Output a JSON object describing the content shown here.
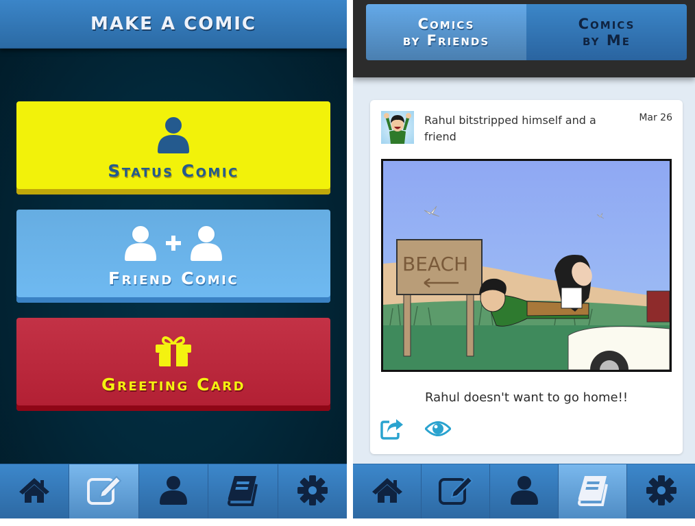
{
  "left_screen": {
    "header": {
      "title": "MAKE A COMIC"
    },
    "buttons": [
      {
        "label": "Status Comic",
        "icon": "person-icon",
        "color": "#f2f20a",
        "text_color": "#245a8e"
      },
      {
        "label": "Friend Comic",
        "icon": "two-persons-plus-icon",
        "color": "#6ab3ea",
        "text_color": "#ffffff",
        "plus": "+"
      },
      {
        "label": "Greeting Card",
        "icon": "gift-icon",
        "color": "#b8283c",
        "text_color": "#f4f210"
      }
    ],
    "tabbar": {
      "active_index": 1,
      "tabs": [
        {
          "icon": "home-icon"
        },
        {
          "icon": "edit-icon"
        },
        {
          "icon": "profile-icon"
        },
        {
          "icon": "book-icon"
        },
        {
          "icon": "settings-gear-icon"
        }
      ]
    }
  },
  "right_screen": {
    "segmented": [
      {
        "line1": "Comics",
        "line2": "by Friends",
        "active": true
      },
      {
        "line1": "Comics",
        "line2": "by Me",
        "active": false
      }
    ],
    "post": {
      "text": "Rahul bitstripped himself and a friend",
      "date": "Mar 26",
      "comic_sign_text": "BEACH",
      "caption": "Rahul doesn't want to go home!!",
      "actions": [
        {
          "icon": "share-icon"
        },
        {
          "icon": "view-eye-icon"
        }
      ]
    },
    "tabbar": {
      "active_index": 3,
      "tabs": [
        {
          "icon": "home-icon"
        },
        {
          "icon": "edit-icon"
        },
        {
          "icon": "profile-icon"
        },
        {
          "icon": "book-icon"
        },
        {
          "icon": "settings-gear-icon"
        }
      ]
    }
  },
  "colors": {
    "accent_blue": "#3b85c8",
    "dark_navy_icon": "#0f2340",
    "action_teal": "#2aa3cf"
  }
}
